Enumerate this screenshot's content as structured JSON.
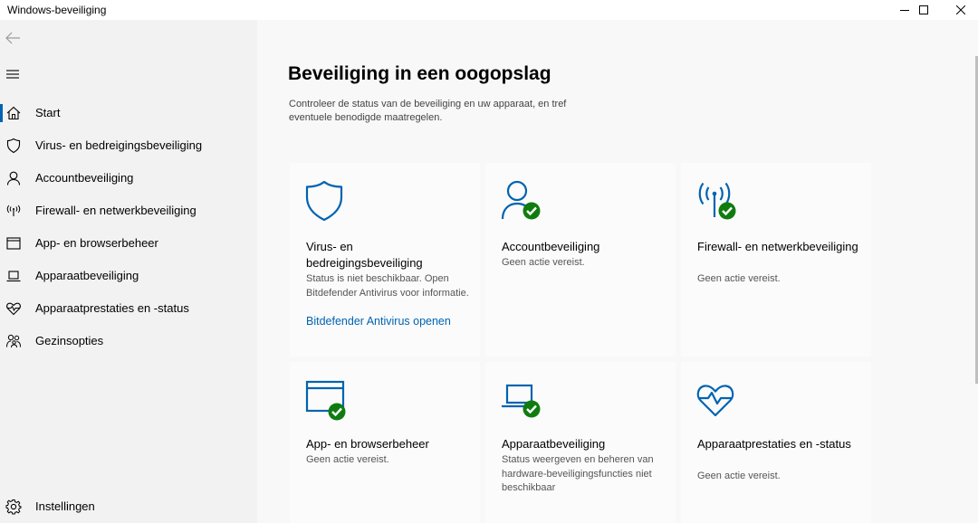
{
  "window": {
    "title": "Windows-beveiliging"
  },
  "sidebar": {
    "items": [
      {
        "label": "Start",
        "icon": "home-icon",
        "active": true
      },
      {
        "label": "Virus- en bedreigingsbeveiliging",
        "icon": "shield-icon"
      },
      {
        "label": "Accountbeveiliging",
        "icon": "person-icon"
      },
      {
        "label": "Firewall- en netwerkbeveiliging",
        "icon": "antenna-icon"
      },
      {
        "label": "App- en browserbeheer",
        "icon": "browser-window-icon"
      },
      {
        "label": "Apparaatbeveiliging",
        "icon": "laptop-icon"
      },
      {
        "label": "Apparaatprestaties en -status",
        "icon": "heart-icon"
      },
      {
        "label": "Gezinsopties",
        "icon": "family-icon"
      }
    ],
    "settings": {
      "label": "Instellingen",
      "icon": "gear-icon"
    }
  },
  "main": {
    "title": "Beveiliging in een oogopslag",
    "description": "Controleer de status van de beveiliging en uw apparaat, en tref eventuele benodigde maatregelen.",
    "cards": [
      {
        "title": "Virus- en bedreigingsbeveiliging",
        "status": "Status is niet beschikbaar. Open Bitdefender Antivirus voor informatie.",
        "link": "Bitdefender Antivirus openen",
        "icon": "shield-icon"
      },
      {
        "title": "Accountbeveiliging",
        "status": "Geen actie vereist.",
        "icon": "person-check-icon"
      },
      {
        "title": "Firewall- en netwerkbeveiliging",
        "status": "Geen actie vereist.",
        "icon": "antenna-check-icon"
      },
      {
        "title": "App- en browserbeheer",
        "status": "Geen actie vereist.",
        "icon": "browser-check-icon"
      },
      {
        "title": "Apparaatbeveiliging",
        "status": "Status weergeven en beheren van hardware-beveiligingsfuncties niet beschikbaar",
        "icon": "laptop-check-icon"
      },
      {
        "title": "Apparaatprestaties en -status",
        "status": "Geen actie vereist.",
        "icon": "heart-pulse-icon"
      }
    ]
  },
  "colors": {
    "accent": "#0063b1",
    "ok": "#107c10"
  }
}
